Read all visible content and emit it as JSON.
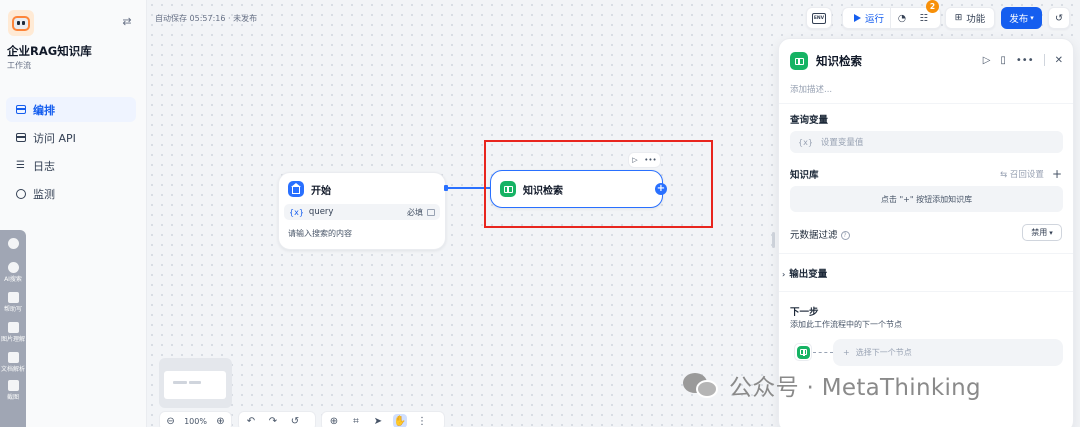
{
  "app": {
    "name": "企业RAG知识库",
    "type": "工作流"
  },
  "nav": [
    {
      "label": "编排",
      "icon": "layout-icon",
      "active": true
    },
    {
      "label": "访问 API",
      "icon": "terminal-icon",
      "active": false
    },
    {
      "label": "日志",
      "icon": "file-list-icon",
      "active": false
    },
    {
      "label": "监测",
      "icon": "dashboard-icon",
      "active": false
    }
  ],
  "dock": [
    {
      "label": "AI搜索"
    },
    {
      "label": "帮助写"
    },
    {
      "label": "图片理解"
    },
    {
      "label": "文档解析"
    },
    {
      "label": "截图"
    }
  ],
  "toolbar": {
    "autosave": "自动保存 05:57:16 · 未发布",
    "env_label": "ENV",
    "run_label": "运行",
    "checklist_count": "2",
    "features_label": "功能",
    "publish_label": "发布"
  },
  "nodes": {
    "start": {
      "title": "开始",
      "var_symbol": "{x}",
      "var_name": "query",
      "var_required": "必填",
      "description": "请输入搜索的内容"
    },
    "knowledge": {
      "title": "知识检索"
    }
  },
  "zoom": {
    "value": "100%"
  },
  "panel": {
    "title": "知识检索",
    "description_placeholder": "添加描述...",
    "query_label": "查询变量",
    "query_symbol": "{x}",
    "query_placeholder": "设置变量值",
    "kb_label": "知识库",
    "kb_recall": "召回设置",
    "kb_empty": "点击 \"+\" 按钮添加知识库",
    "metadata_label": "元数据过滤",
    "metadata_value": "禁用",
    "output_label": "输出变量",
    "next_label": "下一步",
    "next_desc": "添加此工作流程中的下一个节点",
    "next_slot": "选择下一个节点"
  },
  "watermark": {
    "text": "公众号 · MetaThinking"
  },
  "colors": {
    "primary": "#155eef",
    "node_green": "#16b364",
    "badge_orange": "#f79009",
    "highlight_red": "#e8251e"
  }
}
